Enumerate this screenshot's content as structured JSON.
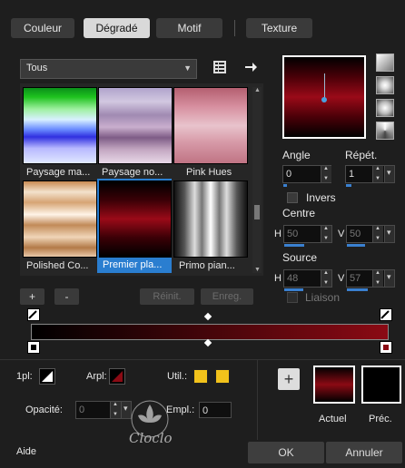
{
  "tabs": [
    "Couleur",
    "Dégradé",
    "Motif",
    "Texture"
  ],
  "category": "Tous",
  "presets": [
    {
      "label": "Paysage ma..."
    },
    {
      "label": "Paysage no..."
    },
    {
      "label": "Pink Hues"
    },
    {
      "label": "Polished Co..."
    },
    {
      "label": "Premier pla..."
    },
    {
      "label": "Primo pian..."
    }
  ],
  "buttons": {
    "add": "+",
    "remove": "-",
    "reinit": "Réinit.",
    "save": "Enreg."
  },
  "angle": {
    "label": "Angle",
    "value": "0"
  },
  "repeat": {
    "label": "Répét.",
    "value": "1"
  },
  "invert": {
    "label": "Invers"
  },
  "centre": {
    "label": "Centre",
    "h_label": "H",
    "h_value": "50",
    "v_label": "V",
    "v_value": "50"
  },
  "source": {
    "label": "Source",
    "h_label": "H",
    "h_value": "48",
    "v_label": "V",
    "v_value": "57"
  },
  "link": {
    "label": "Liaison"
  },
  "bottom": {
    "pl_label": "1pl:",
    "arpl_label": "Arpl:",
    "util_label": "Util.:",
    "opacity_label": "Opacité:",
    "opacity_value": "0",
    "empl_label": "Empl.:",
    "empl_value": "0",
    "current_label": "Actuel",
    "previous_label": "Préc.",
    "plus": "+"
  },
  "footer": {
    "help": "Aide",
    "ok": "OK",
    "cancel": "Annuler"
  },
  "watermark": "Cloclo",
  "colors": {
    "accent": "#3a80d0",
    "gold": "#f2c21b",
    "dark_red": "#8b0a14",
    "background": "#1e1e1e"
  }
}
